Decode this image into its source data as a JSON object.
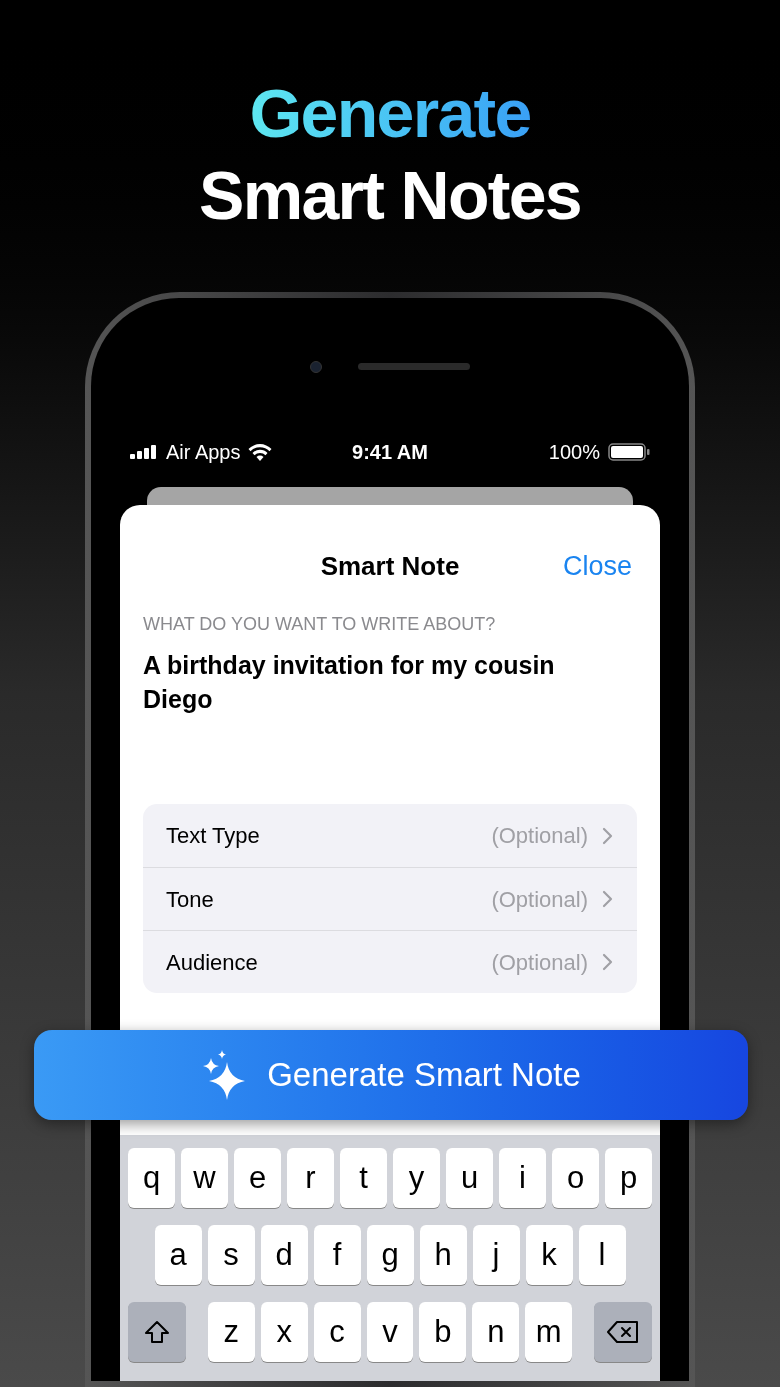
{
  "headline": {
    "accent": "Generate",
    "main": "Smart Notes"
  },
  "status_bar": {
    "carrier": "Air Apps",
    "time": "9:41 AM",
    "battery": "100%"
  },
  "sheet": {
    "title": "Smart Note",
    "close": "Close",
    "prompt_label": "WHAT DO YOU WANT TO WRITE ABOUT?",
    "prompt_value": "A birthday invitation for my cousin Diego",
    "options": [
      {
        "label": "Text Type",
        "value": "(Optional)"
      },
      {
        "label": "Tone",
        "value": "(Optional)"
      },
      {
        "label": "Audience",
        "value": "(Optional)"
      }
    ]
  },
  "generate_button": "Generate Smart Note",
  "keyboard": {
    "rows": [
      [
        "q",
        "w",
        "e",
        "r",
        "t",
        "y",
        "u",
        "i",
        "o",
        "p"
      ],
      [
        "a",
        "s",
        "d",
        "f",
        "g",
        "h",
        "j",
        "k",
        "l"
      ],
      [
        "z",
        "x",
        "c",
        "v",
        "b",
        "n",
        "m"
      ]
    ]
  }
}
